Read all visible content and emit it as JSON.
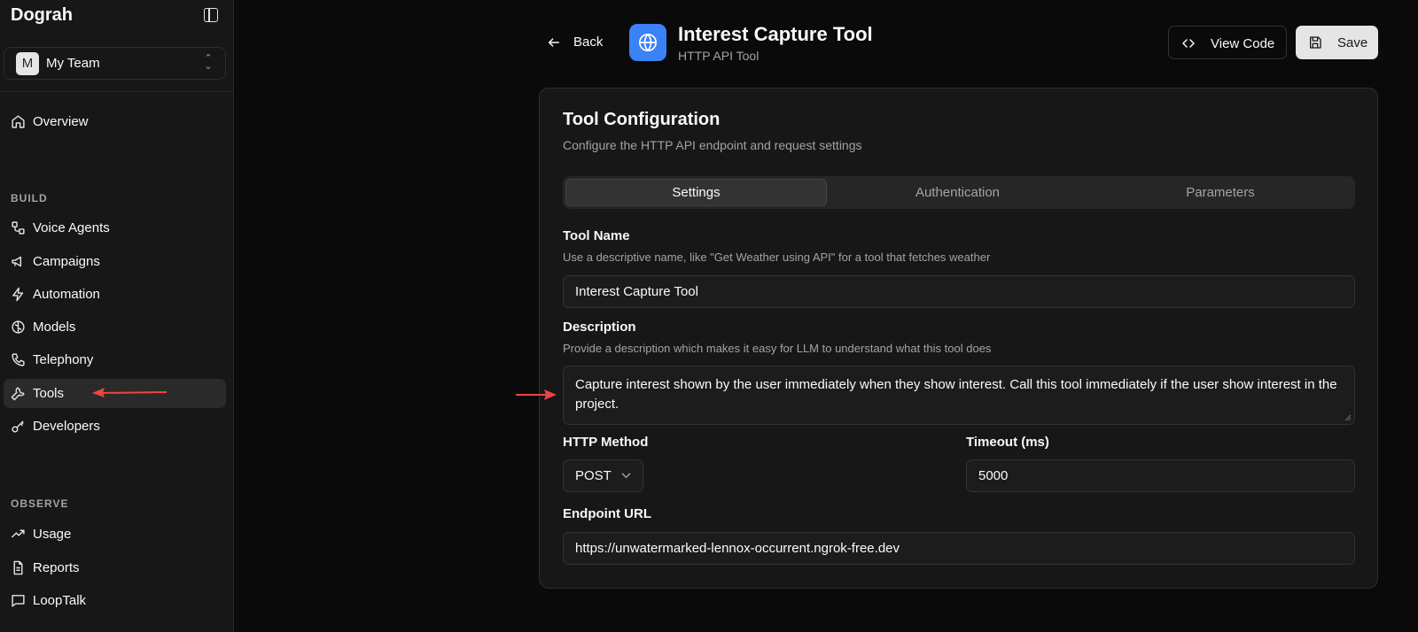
{
  "sidebar": {
    "brand": "Dograh",
    "team": {
      "avatar": "M",
      "name": "My Team"
    },
    "overview": "Overview",
    "build_label": "BUILD",
    "build_items": [
      "Voice Agents",
      "Campaigns",
      "Automation",
      "Models",
      "Telephony",
      "Tools",
      "Developers"
    ],
    "observe_label": "OBSERVE",
    "observe_items": [
      "Usage",
      "Reports",
      "LoopTalk"
    ],
    "active_item": "Tools"
  },
  "header": {
    "back_label": "Back",
    "title": "Interest Capture Tool",
    "subtitle": "HTTP API Tool",
    "view_code_label": "View Code",
    "save_label": "Save",
    "icon": "globe-icon",
    "icon_color": "#3b82f6"
  },
  "card": {
    "title": "Tool Configuration",
    "description": "Configure the HTTP API endpoint and request settings",
    "tabs": [
      "Settings",
      "Authentication",
      "Parameters"
    ],
    "active_tab": "Settings",
    "tool_name": {
      "label": "Tool Name",
      "help": "Use a descriptive name, like \"Get Weather using API\" for a tool that fetches weather",
      "value": "Interest Capture Tool"
    },
    "description_field": {
      "label": "Description",
      "help": "Provide a description which makes it easy for LLM to understand what this tool does",
      "value": "Capture interest shown by the user immediately when they show interest. Call this tool immediately if the user show interest in the project."
    },
    "http_method": {
      "label": "HTTP Method",
      "value": "POST"
    },
    "timeout": {
      "label": "Timeout (ms)",
      "value": "5000"
    },
    "endpoint": {
      "label": "Endpoint URL",
      "value": "https://unwatermarked-lennox-occurrent.ngrok-free.dev"
    }
  },
  "annotation_color": "#ef4444"
}
